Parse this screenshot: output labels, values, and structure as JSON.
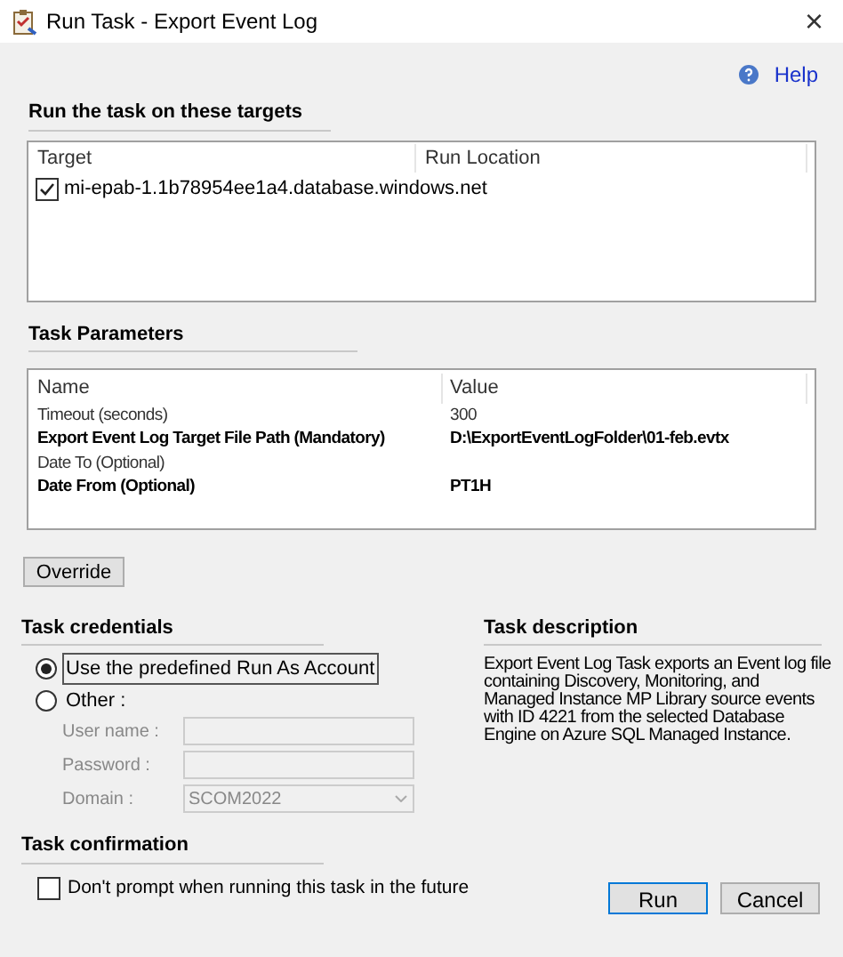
{
  "window": {
    "title": "Run Task - Export Event Log",
    "close": "×"
  },
  "help": {
    "label": "Help"
  },
  "targets": {
    "heading": "Run the task on these targets",
    "columns": [
      "Target",
      "Run Location"
    ],
    "rows": [
      {
        "target": "mi-epab-1.1b78954ee1a4.database.windows.net",
        "checked": true
      }
    ]
  },
  "parameters": {
    "heading": "Task Parameters",
    "columns": [
      "Name",
      "Value"
    ],
    "rows": [
      {
        "name": "Timeout (seconds)",
        "value": "300",
        "bold": false
      },
      {
        "name": "Export Event Log Target File Path (Mandatory)",
        "value": "D:\\ExportEventLogFolder\\01-feb.evtx",
        "bold": true
      },
      {
        "name": "Date To (Optional)",
        "value": "",
        "bold": false
      },
      {
        "name": "Date From (Optional)",
        "value": "PT1H",
        "bold": true
      }
    ]
  },
  "override_button": "Override",
  "credentials": {
    "heading": "Task credentials",
    "options": [
      {
        "label": "Use the predefined Run As Account",
        "selected": true
      },
      {
        "label": "Other :",
        "selected": false
      }
    ],
    "fields": [
      {
        "label": "User name :",
        "kind": "text",
        "disabled": true
      },
      {
        "label": "Password :",
        "kind": "text",
        "disabled": true
      },
      {
        "label": "Domain :",
        "kind": "dropdown",
        "value": "SCOM2022",
        "disabled": true
      }
    ]
  },
  "description": {
    "heading": "Task description",
    "text": "Export Event Log Task exports an Event log file containing Discovery, Monitoring, and Managed Instance MP Library source events with ID 4221 from the selected Database Engine on Azure SQL Managed Instance."
  },
  "confirmation": {
    "heading": "Task confirmation",
    "label": "Don't prompt when running this task in the future",
    "checked": false
  },
  "buttons": [
    {
      "label": "Run",
      "default": true
    },
    {
      "label": "Cancel",
      "default": false
    }
  ]
}
